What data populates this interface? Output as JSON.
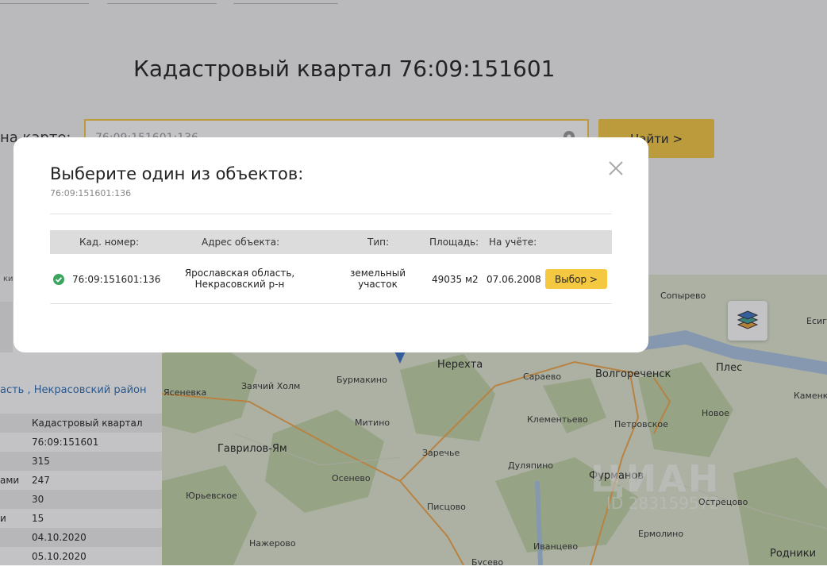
{
  "page": {
    "title": "Кадастровый квартал 76:09:151601",
    "search_label": "на карте:",
    "search_value": "76:09:151601:136",
    "find_button": "Найти >"
  },
  "left_panel": {
    "region_link": "асть , Некрасовский район",
    "tab_label": "кимо",
    "rows": [
      {
        "key": "",
        "value": "Кадастровый квартал"
      },
      {
        "key": "",
        "value": "76:09:151601"
      },
      {
        "key": "",
        "value": "315"
      },
      {
        "key": "ами",
        "value": "247"
      },
      {
        "key": "",
        "value": "30"
      },
      {
        "key": "и",
        "value": "15"
      },
      {
        "key": "",
        "value": "04.10.2020"
      },
      {
        "key": "",
        "value": "05.10.2020"
      }
    ]
  },
  "map": {
    "labels": [
      "Сопырево",
      "Есиг",
      "Нерехта",
      "Сараево",
      "Волгореченск",
      "Плес",
      "Ясеневка",
      "Заячий Холм",
      "Бурмакино",
      "Каменк",
      "Клементьево",
      "Новое",
      "Митино",
      "Петровское",
      "Гаврилов-Ям",
      "Заречье",
      "Осенево",
      "Дуляпино",
      "Фурманов",
      "Юрьевское",
      "Писцово",
      "Острецово",
      "Ермолино",
      "Нажерово",
      "Иванцево",
      "Родники",
      "Бусево"
    ],
    "watermark": "ЦИАН",
    "watermark_id": "ID 283159572",
    "colors": {
      "land": "#dfe7cf",
      "forest": "#c3d3a6",
      "water": "#a9c4e0",
      "road": "#f0a64a"
    }
  },
  "modal": {
    "title": "Выберите один из объектов:",
    "subtitle": "76:09:151601:136",
    "headers": {
      "number": "Кад. номер:",
      "address": "Адрес объекта:",
      "type": "Тип:",
      "area": "Площадь:",
      "registered": "На учёте:"
    },
    "row": {
      "number": "76:09:151601:136",
      "address_line1": "Ярославская область,",
      "address_line2": "Некрасовский р-н",
      "type_line1": "земельный",
      "type_line2": "участок",
      "area": "49035 м2",
      "registered": "07.06.2008",
      "select_button": "Выбор >"
    }
  }
}
